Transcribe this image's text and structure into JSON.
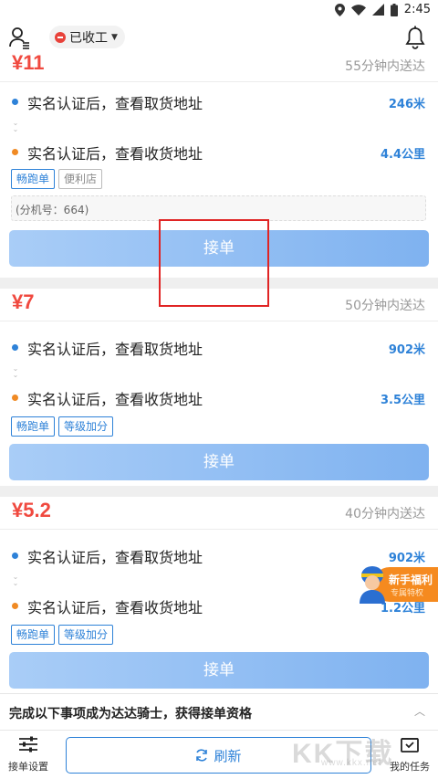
{
  "status_bar": {
    "time": "2:45"
  },
  "header": {
    "work_status": "已收工"
  },
  "orders": [
    {
      "price": "¥11",
      "eta": "55分钟内送达",
      "pickup": {
        "text": "实名认证后，查看取货地址",
        "distance": "246米"
      },
      "dropoff": {
        "text": "实名认证后，查看收货地址",
        "distance": "4.4公里"
      },
      "tags": [
        "畅跑单",
        "便利店"
      ],
      "extension": "(分机号：664)",
      "button": "接单"
    },
    {
      "price": "¥7",
      "eta": "50分钟内送达",
      "pickup": {
        "text": "实名认证后，查看取货地址",
        "distance": "902米"
      },
      "dropoff": {
        "text": "实名认证后，查看收货地址",
        "distance": "3.5公里"
      },
      "tags": [
        "畅跑单",
        "等级加分"
      ],
      "button": "接单"
    },
    {
      "price": "¥5.2",
      "eta": "40分钟内送达",
      "pickup": {
        "text": "实名认证后，查看取货地址",
        "distance": "902米"
      },
      "dropoff": {
        "text": "实名认证后，查看收货地址",
        "distance": "1.2公里"
      },
      "tags": [
        "畅跑单",
        "等级加分"
      ],
      "button": "接单"
    }
  ],
  "promo": {
    "title": "新手福利",
    "subtitle": "专属特权"
  },
  "banner": {
    "text": "完成以下事项成为达达骑士，获得接单资格"
  },
  "bottom": {
    "settings": "接单设置",
    "refresh": "刷新",
    "tasks": "我的任务"
  },
  "watermark": {
    "main": "KK下载",
    "sub": "www.kkx.net"
  },
  "colors": {
    "price": "#f0493f",
    "accent": "#2e82d8",
    "pickup_dot": "#2e82d8",
    "dropoff_dot": "#f08a24",
    "button_from": "#a9cdf7",
    "button_to": "#7fb2f0"
  }
}
